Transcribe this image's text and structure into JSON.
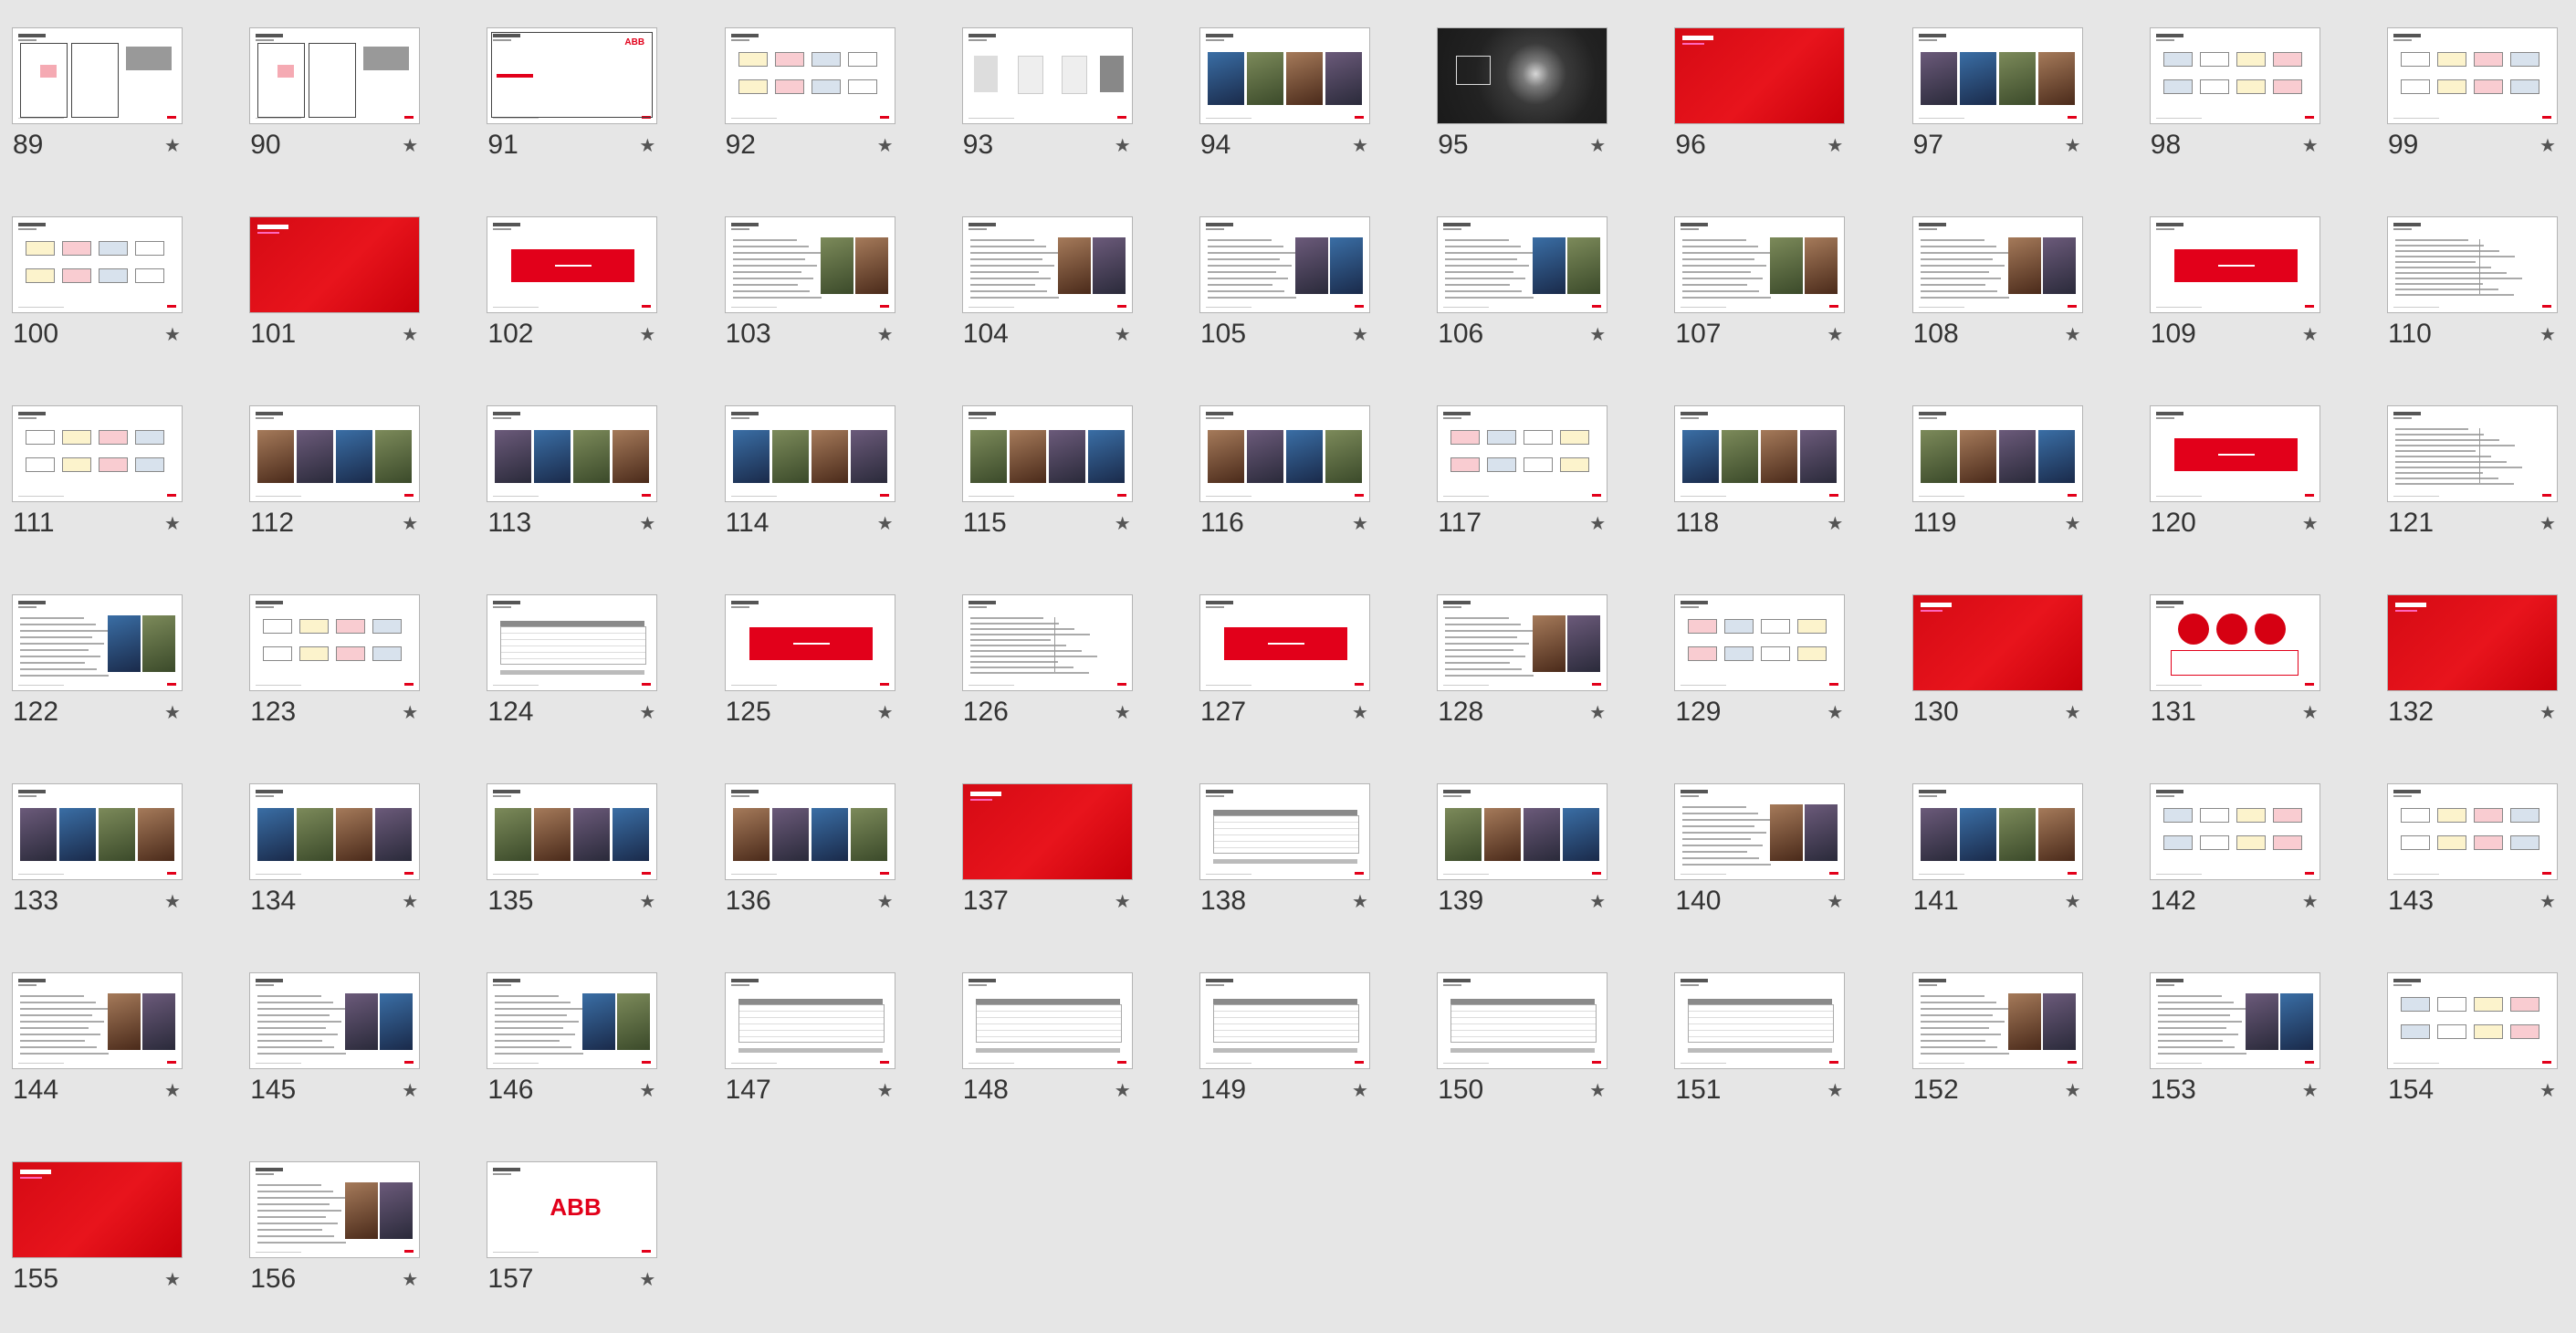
{
  "slides": [
    {
      "num": "89",
      "kind": "doc"
    },
    {
      "num": "90",
      "kind": "doc"
    },
    {
      "num": "91",
      "kind": "abb-cover"
    },
    {
      "num": "92",
      "kind": "diagram"
    },
    {
      "num": "93",
      "kind": "product"
    },
    {
      "num": "94",
      "kind": "photo"
    },
    {
      "num": "95",
      "kind": "dark"
    },
    {
      "num": "96",
      "kind": "red"
    },
    {
      "num": "97",
      "kind": "photo"
    },
    {
      "num": "98",
      "kind": "diagram"
    },
    {
      "num": "99",
      "kind": "diagram"
    },
    {
      "num": "100",
      "kind": "diagram"
    },
    {
      "num": "101",
      "kind": "red"
    },
    {
      "num": "102",
      "kind": "button"
    },
    {
      "num": "103",
      "kind": "text-photo"
    },
    {
      "num": "104",
      "kind": "text-photo"
    },
    {
      "num": "105",
      "kind": "text-photo"
    },
    {
      "num": "106",
      "kind": "text-photo"
    },
    {
      "num": "107",
      "kind": "text-photo"
    },
    {
      "num": "108",
      "kind": "text-photo"
    },
    {
      "num": "109",
      "kind": "button"
    },
    {
      "num": "110",
      "kind": "text"
    },
    {
      "num": "111",
      "kind": "diagram"
    },
    {
      "num": "112",
      "kind": "photo"
    },
    {
      "num": "113",
      "kind": "photo"
    },
    {
      "num": "114",
      "kind": "photo"
    },
    {
      "num": "115",
      "kind": "photo"
    },
    {
      "num": "116",
      "kind": "photo"
    },
    {
      "num": "117",
      "kind": "diagram"
    },
    {
      "num": "118",
      "kind": "photo"
    },
    {
      "num": "119",
      "kind": "photo"
    },
    {
      "num": "120",
      "kind": "button"
    },
    {
      "num": "121",
      "kind": "text"
    },
    {
      "num": "122",
      "kind": "text-photo"
    },
    {
      "num": "123",
      "kind": "diagram"
    },
    {
      "num": "124",
      "kind": "table"
    },
    {
      "num": "125",
      "kind": "button"
    },
    {
      "num": "126",
      "kind": "text"
    },
    {
      "num": "127",
      "kind": "button"
    },
    {
      "num": "128",
      "kind": "text-photo"
    },
    {
      "num": "129",
      "kind": "diagram"
    },
    {
      "num": "130",
      "kind": "red"
    },
    {
      "num": "131",
      "kind": "circles"
    },
    {
      "num": "132",
      "kind": "red"
    },
    {
      "num": "133",
      "kind": "photo"
    },
    {
      "num": "134",
      "kind": "photo"
    },
    {
      "num": "135",
      "kind": "photo"
    },
    {
      "num": "136",
      "kind": "photo"
    },
    {
      "num": "137",
      "kind": "red"
    },
    {
      "num": "138",
      "kind": "table"
    },
    {
      "num": "139",
      "kind": "photo"
    },
    {
      "num": "140",
      "kind": "text-photo"
    },
    {
      "num": "141",
      "kind": "photo"
    },
    {
      "num": "142",
      "kind": "diagram"
    },
    {
      "num": "143",
      "kind": "diagram"
    },
    {
      "num": "144",
      "kind": "text-photo"
    },
    {
      "num": "145",
      "kind": "text-photo"
    },
    {
      "num": "146",
      "kind": "text-photo"
    },
    {
      "num": "147",
      "kind": "table"
    },
    {
      "num": "148",
      "kind": "table"
    },
    {
      "num": "149",
      "kind": "table"
    },
    {
      "num": "150",
      "kind": "table"
    },
    {
      "num": "151",
      "kind": "table"
    },
    {
      "num": "152",
      "kind": "text-photo"
    },
    {
      "num": "153",
      "kind": "text-photo"
    },
    {
      "num": "154",
      "kind": "diagram"
    },
    {
      "num": "155",
      "kind": "red"
    },
    {
      "num": "156",
      "kind": "text-photo"
    },
    {
      "num": "157",
      "kind": "abb-logo"
    }
  ],
  "labels": {
    "abb": "ABB",
    "star": "★"
  },
  "colors": {
    "background": "#e6e6e6",
    "brand_red": "#e2001a",
    "thumb_border": "#b4b4b4",
    "number_text": "#333333"
  }
}
